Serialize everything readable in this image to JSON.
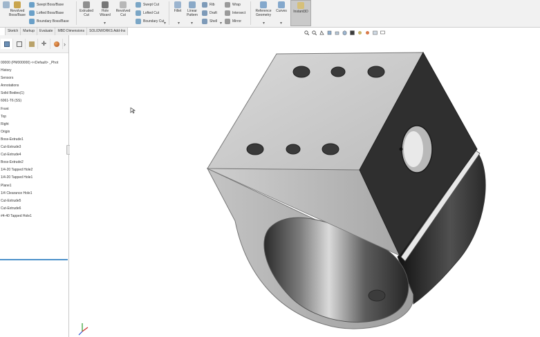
{
  "ribbon": {
    "swept_boss": "Swept Boss/Base",
    "revolved_boss": "Revolved Boss/Base",
    "lofted_boss": "Lofted Boss/Base",
    "boundary_boss": "Boundary Boss/Base",
    "extruded_cut": "Extruded Cut",
    "hole_wizard": "Hole Wizard",
    "revolved_cut": "Revolved Cut",
    "swept_cut": "Swept Cut",
    "lofted_cut": "Lofted Cut",
    "boundary_cut": "Boundary Cut",
    "fillet": "Fillet",
    "linear_pattern": "Linear Pattern",
    "rib": "Rib",
    "draft": "Draft",
    "shell": "Shell",
    "wrap": "Wrap",
    "intersect": "Intersect",
    "mirror": "Mirror",
    "reference_geometry": "Reference Geometry",
    "curves": "Curves",
    "instant3d": "Instant3D"
  },
  "tabs": [
    "Sketch",
    "Markup",
    "Evaluate",
    "MBD Dimensions",
    "SOLIDWORKS Add-Ins"
  ],
  "tree": [
    "00000 (PM000000) <<Default> _Phot",
    "History",
    "Sensors",
    "Annotations",
    "Solid Bodies(1)",
    "6061-T6 (SS)",
    "Front",
    "Top",
    "Right",
    "Origin",
    "Boss-Extrude1",
    "Cut-Extrude3",
    "Cut-Extrude4",
    "Boss-Extrude2",
    "1/4-20 Tapped Hole2",
    "1/4-20 Tapped Hole1",
    "Plane1",
    "1/4 Clearance Hole1",
    "Cut-Extrude5",
    "Cut-Extrude6",
    "#4-40 Tapped Hole1"
  ],
  "colors": {
    "accent": "#4a90c9",
    "ribbon_bg": "#f1f1f1",
    "part_light": "#cdcdcd",
    "part_dark": "#2e2e2e"
  }
}
